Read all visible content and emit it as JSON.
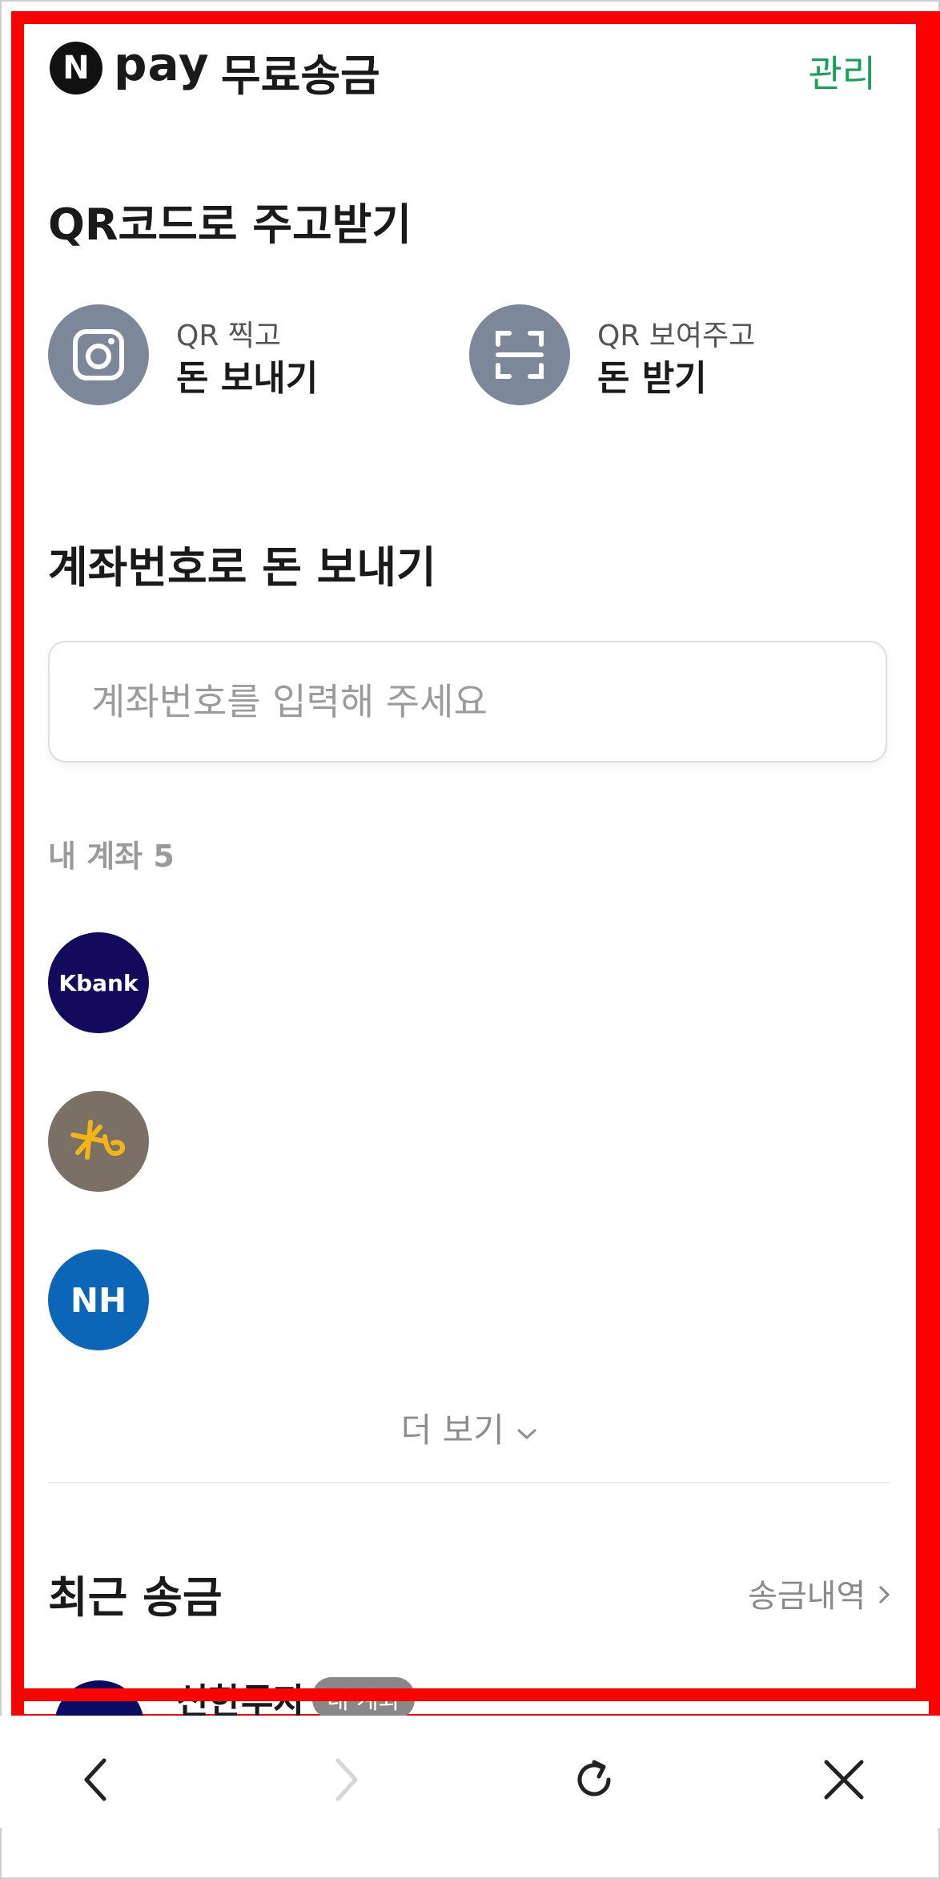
{
  "header": {
    "logo_letter": "N",
    "logo_word": "pay",
    "title": "무료송금",
    "manage_label": "관리"
  },
  "qr_section": {
    "title": "QR코드로 주고받기",
    "send": {
      "sub": "QR 찍고",
      "main": "돈 보내기",
      "icon": "camera-icon"
    },
    "receive": {
      "sub": "QR 보여주고",
      "main": "돈 받기",
      "icon": "scan-frame-icon"
    }
  },
  "account_section": {
    "title": "계좌번호로 돈 보내기",
    "input_placeholder": "계좌번호를 입력해 주세요",
    "input_value": ""
  },
  "my_accounts": {
    "label": "내 계좌 5",
    "banks": [
      {
        "name": "Kbank",
        "color": "#120a5c"
      },
      {
        "name": "KB",
        "color": "#7a7065"
      },
      {
        "name": "NH",
        "color": "#0b66b8"
      }
    ],
    "more_label": "더 보기"
  },
  "recent": {
    "title": "최근 송금",
    "history_label": "송금내역",
    "items": [
      {
        "name": "신한투자",
        "badge": "내 계좌"
      }
    ]
  },
  "browser_nav": {
    "back_icon": "chevron-left-icon",
    "forward_icon": "chevron-right-icon",
    "refresh_icon": "refresh-icon",
    "close_icon": "close-icon"
  },
  "colors": {
    "accent_green": "#1aa058",
    "frame_red": "#ff0000",
    "icon_gray": "#7c8899"
  }
}
